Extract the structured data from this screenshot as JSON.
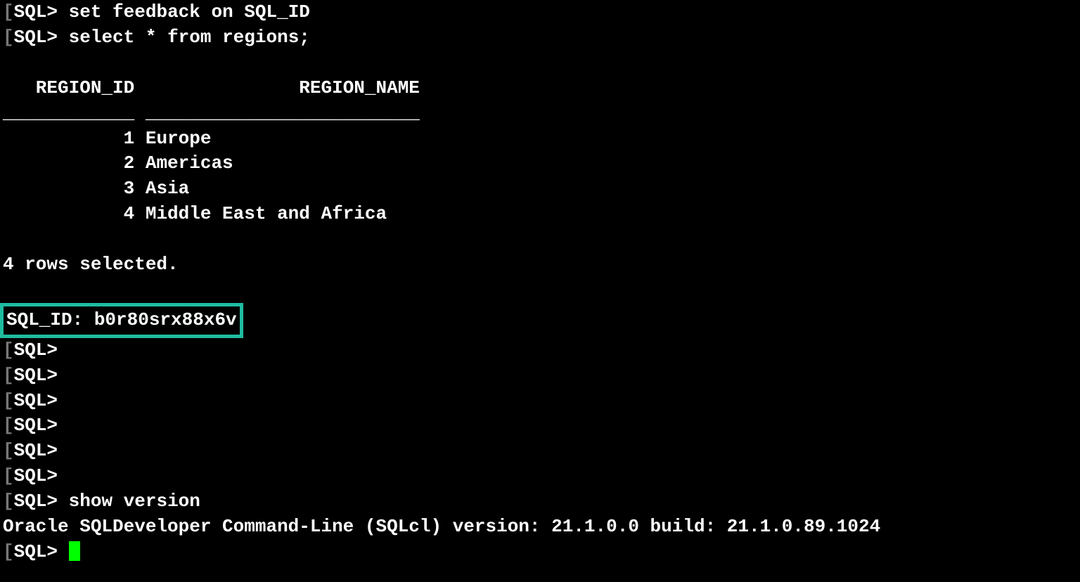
{
  "prompt": "SQL>",
  "bracket_char": "[",
  "commands": {
    "cmd1": "set feedback on SQL_ID",
    "cmd2": "select * from regions;",
    "cmd3": "show version"
  },
  "table": {
    "header_col1": "   REGION_ID",
    "header_col2": "REGION_NAME",
    "sep_col1": "____________",
    "sep_col2": "_________________________",
    "rows": [
      {
        "id": "1",
        "name": "Europe"
      },
      {
        "id": "2",
        "name": "Americas"
      },
      {
        "id": "3",
        "name": "Asia"
      },
      {
        "id": "4",
        "name": "Middle East and Africa"
      }
    ],
    "row1_id": "           1",
    "row1_name": "Europe",
    "row2_id": "           2",
    "row2_name": "Americas",
    "row3_id": "           3",
    "row3_name": "Asia",
    "row4_id": "           4",
    "row4_name": "Middle East and Africa"
  },
  "feedback": "4 rows selected.",
  "sql_id_label": "SQL_ID: b0r80srx88x6v",
  "version_output": "Oracle SQLDeveloper Command-Line (SQLcl) version: 21.1.0.0 build: 21.1.0.89.1024",
  "highlight_color": "#1fbca0",
  "cursor_color": "#00ff00"
}
